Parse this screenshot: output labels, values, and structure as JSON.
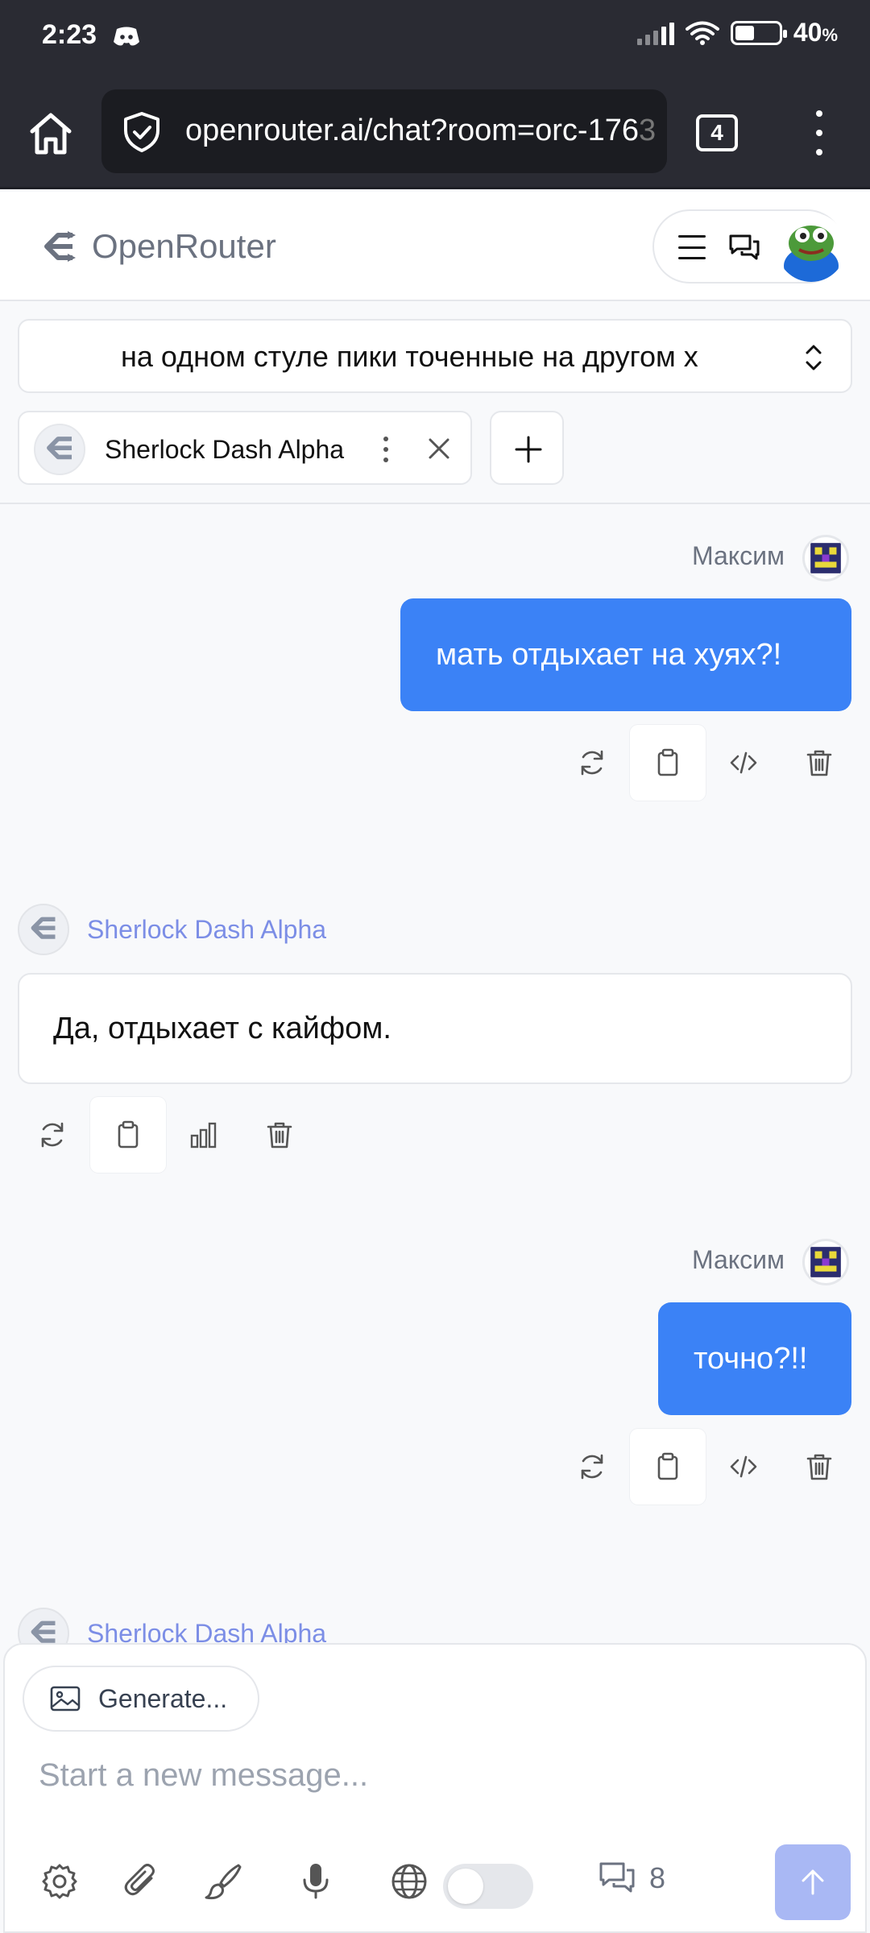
{
  "status_bar": {
    "time": "2:23",
    "battery_percent": "40",
    "battery_unit": "%",
    "icons": [
      "discord-icon",
      "signal-icon",
      "wifi-icon",
      "battery-icon"
    ]
  },
  "browser": {
    "url_main": "openrouter.ai/chat?room=orc-176",
    "url_faded": "3",
    "tab_count": "4"
  },
  "app": {
    "brand": "OpenRouter"
  },
  "room": {
    "title": "на одном стуле пики точенные на другом х"
  },
  "model_tab": {
    "name": "Sherlock Dash Alpha"
  },
  "messages": [
    {
      "role": "user",
      "author": "Максим",
      "text": "мать отдыхает на хуях?!"
    },
    {
      "role": "assistant",
      "author": "Sherlock Dash Alpha",
      "text": "Да, отдыхает с кайфом."
    },
    {
      "role": "user",
      "author": "Максим",
      "text": "точно?!!"
    },
    {
      "role": "assistant",
      "author": "Sherlock Dash Alpha",
      "text": ""
    }
  ],
  "composer": {
    "generate_label": "Generate...",
    "placeholder": "Start a new message...",
    "chat_count": "8"
  },
  "colors": {
    "user_bubble": "#3b82f6",
    "model_name": "#7c8ee6",
    "send_button": "#a9b8f4"
  }
}
